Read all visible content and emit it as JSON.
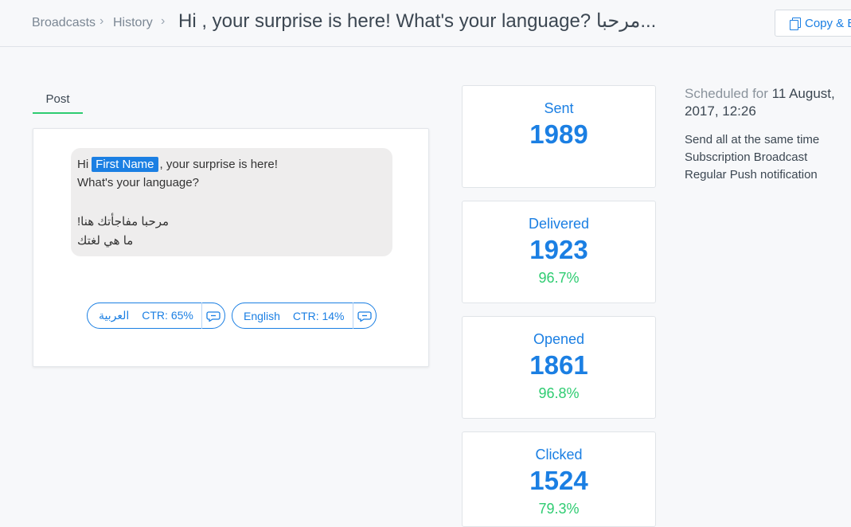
{
  "breadcrumb": {
    "items": [
      {
        "label": "Broadcasts"
      },
      {
        "label": "History"
      }
    ],
    "separator": "›",
    "title": "Hi , your surprise is here! What's your language? مرحبا..."
  },
  "toolbar": {
    "copy_label": "Copy & E"
  },
  "tabs": {
    "post_label": "Post"
  },
  "message": {
    "greeting": "Hi",
    "first_name_chip": "First Name",
    "line1_rest": ", your surprise is here!",
    "line2": "What's your language?",
    "line3": "مرحبا مفاجأتك هنا!",
    "line4": "ما هي لغتك"
  },
  "quick_replies": [
    {
      "label": "العربية",
      "ctr": "CTR: 65%"
    },
    {
      "label": "English",
      "ctr": "CTR: 14%"
    }
  ],
  "stats": [
    {
      "label": "Sent",
      "value": "1989",
      "pct": ""
    },
    {
      "label": "Delivered",
      "value": "1923",
      "pct": "96.7%"
    },
    {
      "label": "Opened",
      "value": "1861",
      "pct": "96.8%"
    },
    {
      "label": "Clicked",
      "value": "1524",
      "pct": "79.3%"
    }
  ],
  "schedule": {
    "prefix": "Scheduled for ",
    "date": "11 August, 2017, 12:26",
    "details": [
      "Send all at the same time",
      "Subscription Broadcast",
      "Regular Push notification"
    ]
  },
  "colors": {
    "accent": "#1b7fe3",
    "success": "#2ecc71",
    "bubble": "#eeeded"
  }
}
